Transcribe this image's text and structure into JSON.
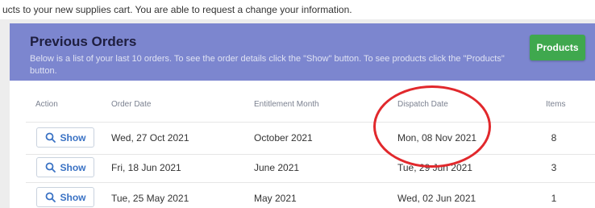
{
  "intro_text": "ucts to your new supplies cart. You are able to request a change your information.",
  "panel": {
    "title": "Previous Orders",
    "subtitle": "Below is a list of your last 10 orders. To see the order details click the \"Show\" button. To see products click the \"Products\" button.",
    "products_label": "Products"
  },
  "table": {
    "headers": [
      "Action",
      "Order Date",
      "Entitlement Month",
      "Dispatch Date",
      "Items"
    ],
    "show_label": "Show",
    "rows": [
      {
        "order_date": "Wed, 27 Oct 2021",
        "entitlement_month": "October 2021",
        "dispatch_date": "Mon, 08 Nov 2021",
        "items": "8"
      },
      {
        "order_date": "Fri, 18 Jun 2021",
        "entitlement_month": "June 2021",
        "dispatch_date": "Tue, 29 Jun 2021",
        "items": "3"
      },
      {
        "order_date": "Tue, 25 May 2021",
        "entitlement_month": "May 2021",
        "dispatch_date": "Wed, 02 Jun 2021",
        "items": "1"
      }
    ]
  },
  "colors": {
    "header_bg": "#7c86cf",
    "products_button": "#3fa84e",
    "show_text": "#3a72c4",
    "annotation_circle": "#e1282c"
  },
  "icons": {
    "show": "search-icon"
  }
}
